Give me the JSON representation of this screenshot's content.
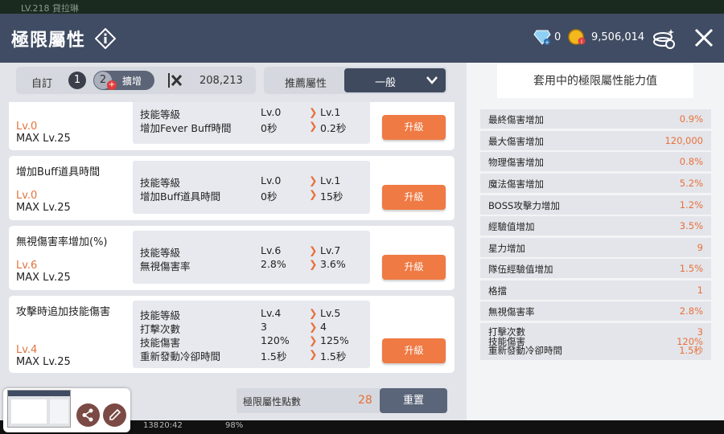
{
  "header": {
    "title": "極限屬性",
    "diamond": "0",
    "gold": "9,506,014",
    "behind_text": "LV.218 貸拉琳"
  },
  "filter": {
    "custom": "自訂",
    "preset1": "1",
    "preset2": "2",
    "expand": "擴增",
    "count": "208,213",
    "recommend": "推薦屬性",
    "selected": "一般"
  },
  "skills": [
    {
      "name": "",
      "level": "Lv.0",
      "max": "MAX Lv.25",
      "rows": [
        {
          "k": "技能等級",
          "a": "Lv.0",
          "b": "Lv.1"
        },
        {
          "k": "增加Fever Buff時間",
          "a": "0秒",
          "b": "0.2秒"
        }
      ],
      "btn": "升級"
    },
    {
      "name": "增加Buff道具時間",
      "level": "Lv.0",
      "max": "MAX Lv.25",
      "rows": [
        {
          "k": "技能等級",
          "a": "Lv.0",
          "b": "Lv.1"
        },
        {
          "k": "增加Buff道具時間",
          "a": "0秒",
          "b": "15秒"
        }
      ],
      "btn": "升級"
    },
    {
      "name": "無視傷害率增加(%)",
      "level": "Lv.6",
      "max": "MAX Lv.25",
      "rows": [
        {
          "k": "技能等級",
          "a": "Lv.6",
          "b": "Lv.7"
        },
        {
          "k": "無視傷害率",
          "a": "2.8%",
          "b": "3.6%"
        }
      ],
      "btn": "升級"
    },
    {
      "name": "攻擊時追加技能傷害",
      "level": "Lv.4",
      "max": "MAX Lv.25",
      "rows": [
        {
          "k": "技能等級",
          "a": "Lv.4",
          "b": "Lv.5"
        },
        {
          "k": "打擊次數",
          "a": "3",
          "b": "4"
        },
        {
          "k": "技能傷害",
          "a": "120%",
          "b": "125%"
        },
        {
          "k": "重新發動冷卻時間",
          "a": "1.5秒",
          "b": "1.5秒"
        }
      ],
      "btn": "升級"
    }
  ],
  "points": {
    "label": "極限屬性點數",
    "value": "28",
    "reset": "重置"
  },
  "stats": {
    "title": "套用中的極限屬性能力值",
    "items": [
      {
        "k": "最終傷害增加",
        "v": "0.9%"
      },
      {
        "k": "最大傷害增加",
        "v": "120,000"
      },
      {
        "k": "物理傷害增加",
        "v": "0.8%"
      },
      {
        "k": "魔法傷害增加",
        "v": "5.2%"
      },
      {
        "k": "BOSS攻擊力增加",
        "v": "1.2%"
      },
      {
        "k": "經驗值增加",
        "v": "3.5%"
      },
      {
        "k": "星力增加",
        "v": "9"
      },
      {
        "k": "隊伍經驗值增加",
        "v": "1.5%"
      },
      {
        "k": "格擋",
        "v": "1"
      },
      {
        "k": "無視傷害率",
        "v": "2.8%"
      }
    ],
    "multi": {
      "k1": "打擊次數",
      "k2": "技能傷害",
      "k3": "重新發動冷卻時間",
      "v1": "3",
      "v2": "120%",
      "v3": "1.5秒"
    }
  },
  "statusbar": {
    "ping": "138",
    "time": "20:42",
    "battery": "98%"
  },
  "colors": {
    "accent": "#ef7a44",
    "header": "#404c63"
  }
}
